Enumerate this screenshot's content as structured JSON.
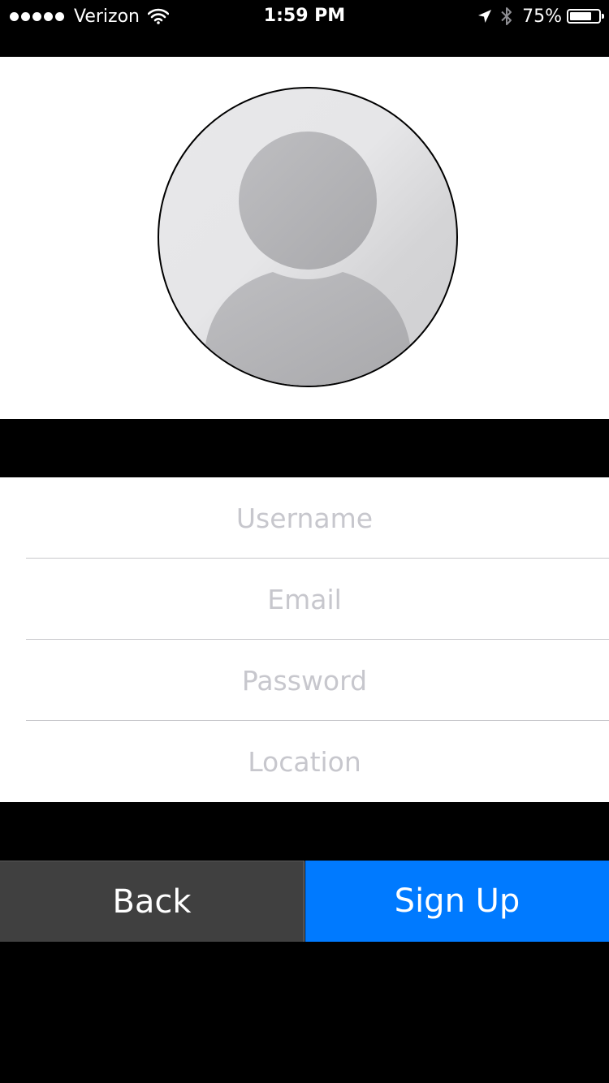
{
  "status_bar": {
    "signal_bars": 5,
    "carrier": "Verizon",
    "time": "1:59 PM",
    "battery_percent": "75%",
    "battery_level": 0.75,
    "icons": [
      "signal-dots-icon",
      "wifi-icon",
      "location-arrow-icon",
      "bluetooth-icon",
      "battery-icon"
    ]
  },
  "avatar": {
    "icon": "user-placeholder-icon"
  },
  "form": {
    "username_placeholder": "Username",
    "username_value": "",
    "email_placeholder": "Email",
    "email_value": "",
    "password_placeholder": "Password",
    "password_value": "",
    "location_placeholder": "Location",
    "location_value": ""
  },
  "buttons": {
    "back_label": "Back",
    "signup_label": "Sign Up"
  },
  "colors": {
    "background": "#000000",
    "panel": "#ffffff",
    "placeholder_text": "#c7c7cd",
    "back_button": "#404040",
    "signup_button": "#007aff"
  }
}
